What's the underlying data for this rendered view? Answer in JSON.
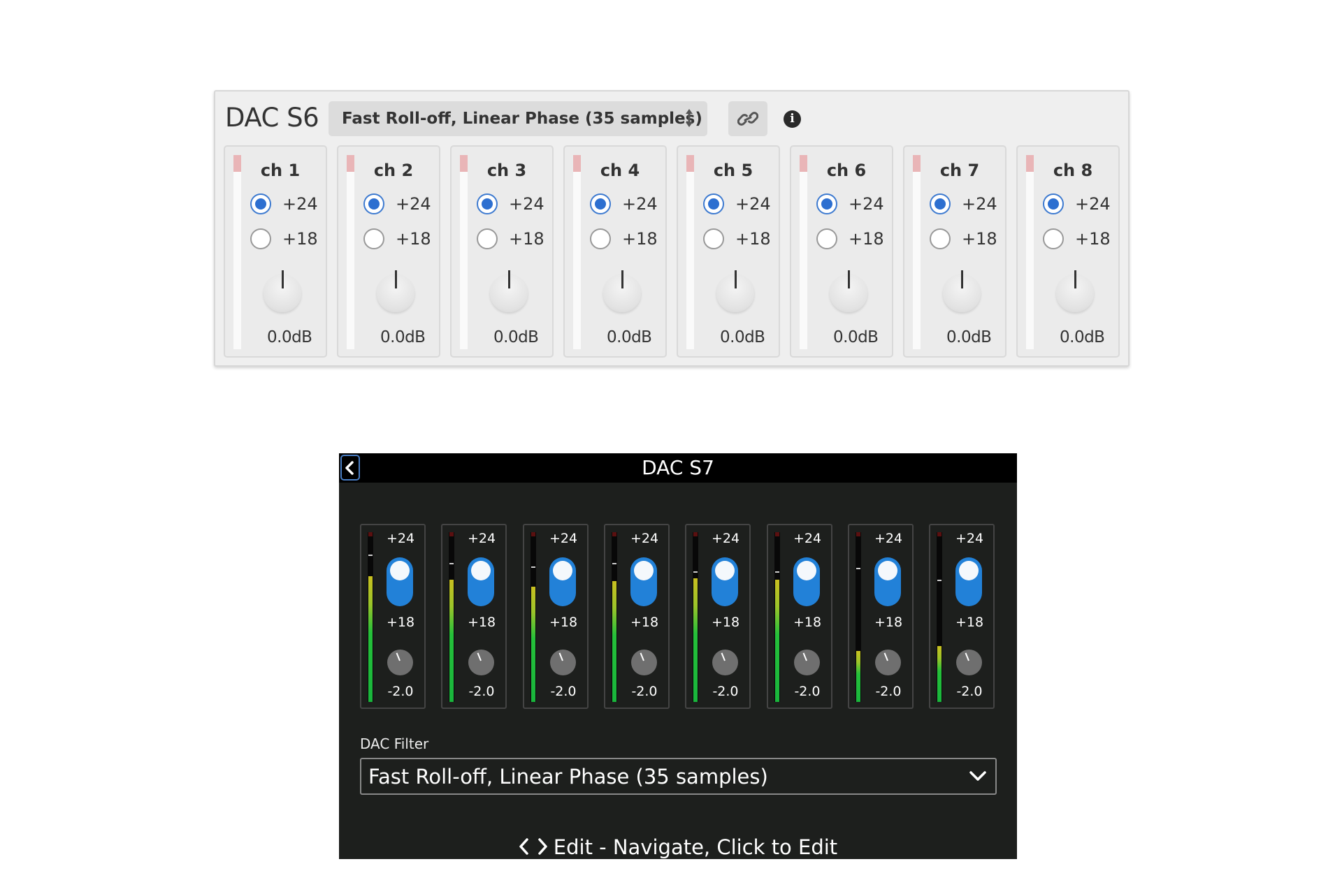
{
  "s6": {
    "title": "DAC S6",
    "filter_value": "Fast Roll-off, Linear Phase (35 samples)",
    "icons": [
      "up-down-arrows-icon",
      "link-icon",
      "info-icon"
    ],
    "info_glyph": "i",
    "channels": [
      {
        "name": "ch 1",
        "opt_a": "+24",
        "opt_b": "+18",
        "selected": "+24",
        "gain": "0.0dB"
      },
      {
        "name": "ch 2",
        "opt_a": "+24",
        "opt_b": "+18",
        "selected": "+24",
        "gain": "0.0dB"
      },
      {
        "name": "ch 3",
        "opt_a": "+24",
        "opt_b": "+18",
        "selected": "+24",
        "gain": "0.0dB"
      },
      {
        "name": "ch 4",
        "opt_a": "+24",
        "opt_b": "+18",
        "selected": "+24",
        "gain": "0.0dB"
      },
      {
        "name": "ch 5",
        "opt_a": "+24",
        "opt_b": "+18",
        "selected": "+24",
        "gain": "0.0dB"
      },
      {
        "name": "ch 6",
        "opt_a": "+24",
        "opt_b": "+18",
        "selected": "+24",
        "gain": "0.0dB"
      },
      {
        "name": "ch 7",
        "opt_a": "+24",
        "opt_b": "+18",
        "selected": "+24",
        "gain": "0.0dB"
      },
      {
        "name": "ch 8",
        "opt_a": "+24",
        "opt_b": "+18",
        "selected": "+24",
        "gain": "0.0dB"
      }
    ],
    "colors": {
      "accent": "#2d6fd0",
      "peak": "#e9b5b7"
    }
  },
  "s7": {
    "title": "DAC S7",
    "filter_label": "DAC Filter",
    "filter_value": "Fast Roll-off, Linear Phase (35 samples)",
    "footer": "Edit - Navigate, Click to Edit",
    "icons": [
      "back-chevron-icon",
      "chevron-down-icon",
      "left-right-chevrons-icon"
    ],
    "channels": [
      {
        "top": "+24",
        "bottom": "+18",
        "switch": "+24",
        "gain": "-2.0",
        "level": 0.74,
        "peak": 0.87
      },
      {
        "top": "+24",
        "bottom": "+18",
        "switch": "+24",
        "gain": "-2.0",
        "level": 0.72,
        "peak": 0.82
      },
      {
        "top": "+24",
        "bottom": "+18",
        "switch": "+24",
        "gain": "-2.0",
        "level": 0.68,
        "peak": 0.8
      },
      {
        "top": "+24",
        "bottom": "+18",
        "switch": "+24",
        "gain": "-2.0",
        "level": 0.71,
        "peak": 0.82
      },
      {
        "top": "+24",
        "bottom": "+18",
        "switch": "+24",
        "gain": "-2.0",
        "level": 0.73,
        "peak": 0.77
      },
      {
        "top": "+24",
        "bottom": "+18",
        "switch": "+24",
        "gain": "-2.0",
        "level": 0.72,
        "peak": 0.77
      },
      {
        "top": "+24",
        "bottom": "+18",
        "switch": "+24",
        "gain": "-2.0",
        "level": 0.3,
        "peak": 0.79
      },
      {
        "top": "+24",
        "bottom": "+18",
        "switch": "+24",
        "gain": "-2.0",
        "level": 0.33,
        "peak": 0.72
      }
    ],
    "colors": {
      "toggle": "#2281d8",
      "meter_green": "#19b53c"
    }
  }
}
